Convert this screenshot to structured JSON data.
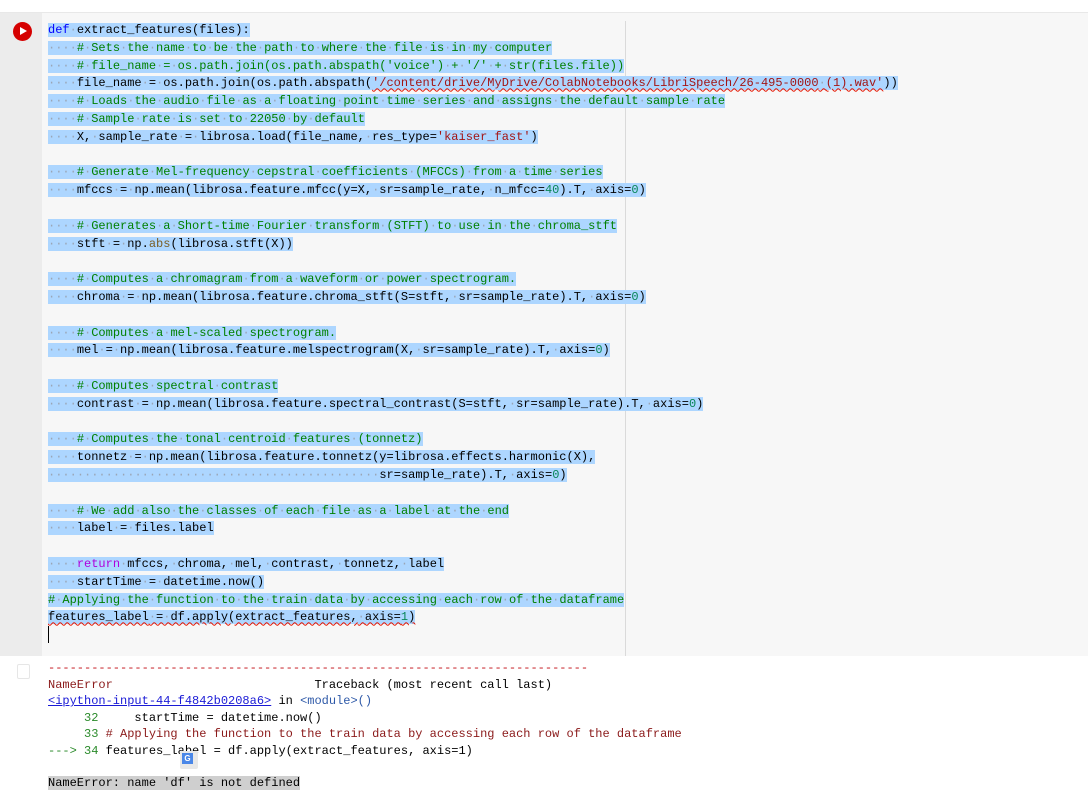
{
  "cell": {
    "run_button": "run-cell",
    "lines": [
      "def extract_features(files):",
      "    # Sets the name to be the path to where the file is in my computer",
      "    # file_name = os.path.join(os.path.abspath('voice') + '/' + str(files.file))",
      "    file_name = os.path.join(os.path.abspath('/content/drive/MyDrive/ColabNotebooks/LibriSpeech/26-495-0000 (1).wav'))",
      "    # Loads the audio file as a floating point time series and assigns the default sample rate",
      "    # Sample rate is set to 22050 by default",
      "    X, sample_rate = librosa.load(file_name, res_type='kaiser_fast')",
      "",
      "    # Generate Mel-frequency cepstral coefficients (MFCCs) from a time series",
      "    mfccs = np.mean(librosa.feature.mfcc(y=X, sr=sample_rate, n_mfcc=40).T, axis=0)",
      "",
      "    # Generates a Short-time Fourier transform (STFT) to use in the chroma_stft",
      "    stft = np.abs(librosa.stft(X))",
      "",
      "    # Computes a chromagram from a waveform or power spectrogram.",
      "    chroma = np.mean(librosa.feature.chroma_stft(S=stft, sr=sample_rate).T, axis=0)",
      "",
      "    # Computes a mel-scaled spectrogram.",
      "    mel = np.mean(librosa.feature.melspectrogram(X, sr=sample_rate).T, axis=0)",
      "",
      "    # Computes spectral contrast",
      "    contrast = np.mean(librosa.feature.spectral_contrast(S=stft, sr=sample_rate).T, axis=0)",
      "",
      "    # Computes the tonal centroid features (tonnetz)",
      "    tonnetz = np.mean(librosa.feature.tonnetz(y=librosa.effects.harmonic(X),",
      "                                              sr=sample_rate).T, axis=0)",
      "",
      "    # We add also the classes of each file as a label at the end",
      "    label = files.label",
      "",
      "    return mfccs, chroma, mel, contrast, tonnetz, label",
      "    startTime = datetime.now()",
      "# Applying the function to the train data by accessing each row of the dataframe",
      "features_label = df.apply(extract_features, axis=1)"
    ]
  },
  "output": {
    "dashes": "---------------------------------------------------------------------------",
    "error_name": "NameError",
    "traceback_label": "Traceback (most recent call last)",
    "link": "<ipython-input-44-f4842b0208a6>",
    "in_text": " in ",
    "module": "<module>()",
    "line32_num": "     32",
    "line32_code": "     startTime = datetime.now()",
    "line33_num": "     33",
    "line33_code": " # Applying the function to the train data by accessing each row of the dataframe",
    "line34_arrow": "---> 34",
    "line34_code": " features_label = df.apply(extract_features, axis=1)",
    "error_message": "NameError: name 'df' is not defined"
  },
  "colors": {
    "run_button": "#d50000",
    "selection": "#add6ff"
  },
  "icons": {
    "translate": "google-translate-icon"
  }
}
